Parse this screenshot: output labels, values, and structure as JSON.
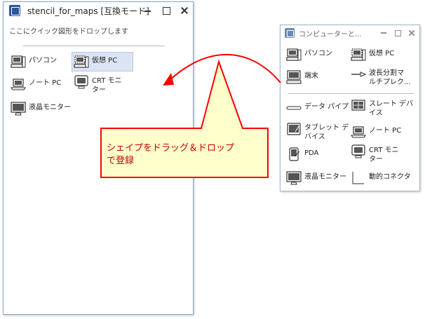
{
  "left_window": {
    "title": "stencil_for_maps [互換モード]",
    "hint": "ここにクイック図形をドロップします",
    "shapes": [
      {
        "label": "パソコン",
        "icon": "pc-icon"
      },
      {
        "label": "仮想 PC",
        "icon": "virtual-pc-icon"
      },
      {
        "label": "ノート PC",
        "icon": "laptop-icon"
      },
      {
        "label": "CRT モニ\nター",
        "icon": "crt-monitor-icon"
      },
      {
        "label": "液晶モニター",
        "icon": "lcd-monitor-icon"
      }
    ]
  },
  "right_window": {
    "title": "コンピューターと...",
    "shapes": [
      {
        "label": "パソコン",
        "icon": "pc-icon"
      },
      {
        "label": "仮想 PC",
        "icon": "virtual-pc-icon"
      },
      {
        "label": "端末",
        "icon": "terminal-icon"
      },
      {
        "label": "波長分割マ\nルチプレク...",
        "icon": "wdm-icon"
      },
      {
        "label": "データ パイプ",
        "icon": "data-pipe-icon"
      },
      {
        "label": "スレート デバ\nイス",
        "icon": "slate-device-icon"
      },
      {
        "label": "タブレット デ\nバイス",
        "icon": "tablet-icon"
      },
      {
        "label": "ノート PC",
        "icon": "laptop-icon"
      },
      {
        "label": "PDA",
        "icon": "pda-icon"
      },
      {
        "label": "CRT モニ\nター",
        "icon": "crt-monitor-icon"
      },
      {
        "label": "液晶モニター",
        "icon": "lcd-monitor-icon"
      },
      {
        "label": "動的コネクタ",
        "icon": "dynamic-connector-icon"
      }
    ]
  },
  "callout": {
    "text_line1": "シェイプをドラッグ＆ドロップ",
    "text_line2": "で登録"
  },
  "colors": {
    "callout_fill": "#ffffcc",
    "callout_border": "#ff0000",
    "callout_text": "#c00000",
    "arrow": "#ff0000",
    "selected_bg": "#dbe4f5"
  }
}
